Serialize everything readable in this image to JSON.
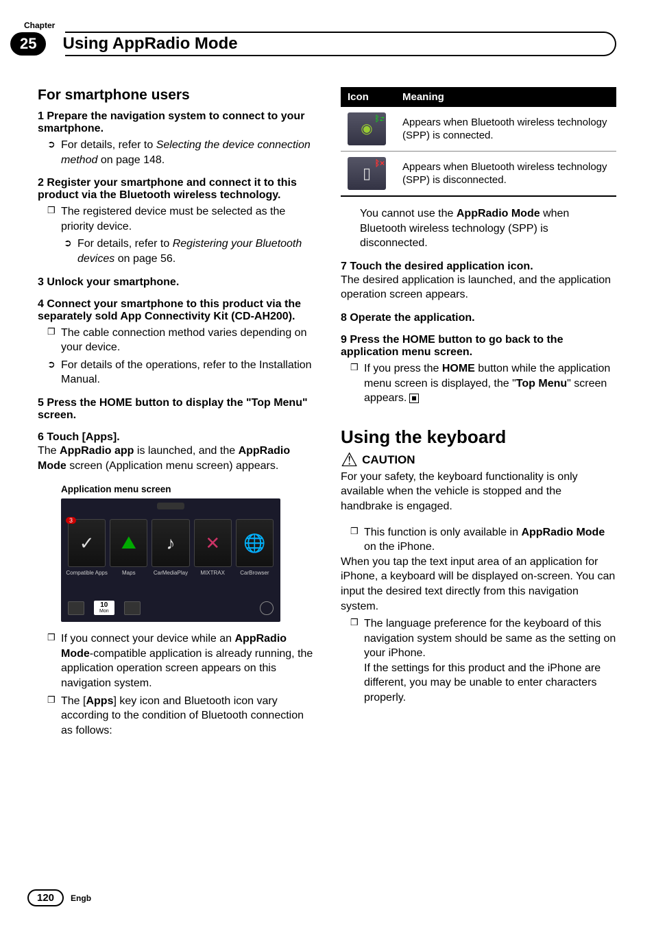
{
  "chapter": {
    "label": "Chapter",
    "number": "25",
    "title": "Using AppRadio Mode"
  },
  "left": {
    "section_title": "For smartphone users",
    "step1_h": "1   Prepare the navigation system to connect to your smartphone.",
    "step1_b1a": "For details, refer to ",
    "step1_b1b": "Selecting the device connection method",
    "step1_b1c": " on page 148.",
    "step2_h": "2   Register your smartphone and connect it to this product via the Bluetooth wireless technology.",
    "step2_b1": "The registered device must be selected as the priority device.",
    "step2_b2a": "For details, refer to ",
    "step2_b2b": "Registering your Bluetooth devices",
    "step2_b2c": " on page 56.",
    "step3_h": "3   Unlock your smartphone.",
    "step4_h": "4   Connect your smartphone to this product via the separately sold App Connectivity Kit (CD-AH200).",
    "step4_b1": "The cable connection method varies depending on your device.",
    "step4_b2": "For details of the operations, refer to the Installation Manual.",
    "step5_h": "5   Press the HOME button to display the \"Top Menu\" screen.",
    "step6_h": "6   Touch [Apps].",
    "step6_p_a": "The ",
    "step6_p_b": "AppRadio app",
    "step6_p_c": " is launched, and the ",
    "step6_p_d": "AppRadio Mode",
    "step6_p_e": " screen (Application menu screen) appears.",
    "figure_caption": "Application menu screen",
    "app_tiles": {
      "t1": "Compatible Apps",
      "t2": "Maps",
      "t3": "CarMediaPlay",
      "t4": "MIXTRAX",
      "t5": "CarBrowser",
      "badge": "3",
      "date_num": "10",
      "date_day": "Mon"
    },
    "post1a": "If you connect your device while an ",
    "post1b": "AppRadio Mode",
    "post1c": "-compatible application is already running, the application operation screen appears on this navigation system.",
    "post2a": "The [",
    "post2b": "Apps",
    "post2c": "] key icon and Bluetooth icon vary according to the condition of Bluetooth connection as follows:"
  },
  "right": {
    "table": {
      "h1": "Icon",
      "h2": "Meaning",
      "r1": "Appears when Bluetooth wireless technology (SPP) is connected.",
      "r2": "Appears when Bluetooth wireless technology (SPP) is disconnected."
    },
    "note_a": "You cannot use the ",
    "note_b": "AppRadio Mode",
    "note_c": " when Bluetooth wireless technology (SPP) is disconnected.",
    "step7_h": "7   Touch the desired application icon.",
    "step7_p": "The desired application is launched, and the application operation screen appears.",
    "step8_h": "8   Operate the application.",
    "step9_h": "9   Press the HOME button to go back to the application menu screen.",
    "step9_b1a": "If you press the ",
    "step9_b1b": "HOME",
    "step9_b1c": " button while the application menu screen is displayed, the \"",
    "step9_b1d": "Top Menu",
    "step9_b1e": "\" screen appears.",
    "kb_title": "Using the keyboard",
    "caution_label": "CAUTION",
    "caution_p": "For your safety, the keyboard functionality is only available when the vehicle is stopped and the handbrake is engaged.",
    "kb_b1a": "This function is only available in ",
    "kb_b1b": "AppRadio Mode",
    "kb_b1c": " on the iPhone.",
    "kb_p": "When you tap the text input area of an application for iPhone, a keyboard will be displayed on-screen. You can input the desired text directly from this navigation system.",
    "kb_b2": "The language preference for the keyboard of this navigation system should be same as the setting on your iPhone.\nIf the settings for this product and the iPhone are different, you may be unable to enter characters properly."
  },
  "footer": {
    "page": "120",
    "lang": "Engb"
  }
}
